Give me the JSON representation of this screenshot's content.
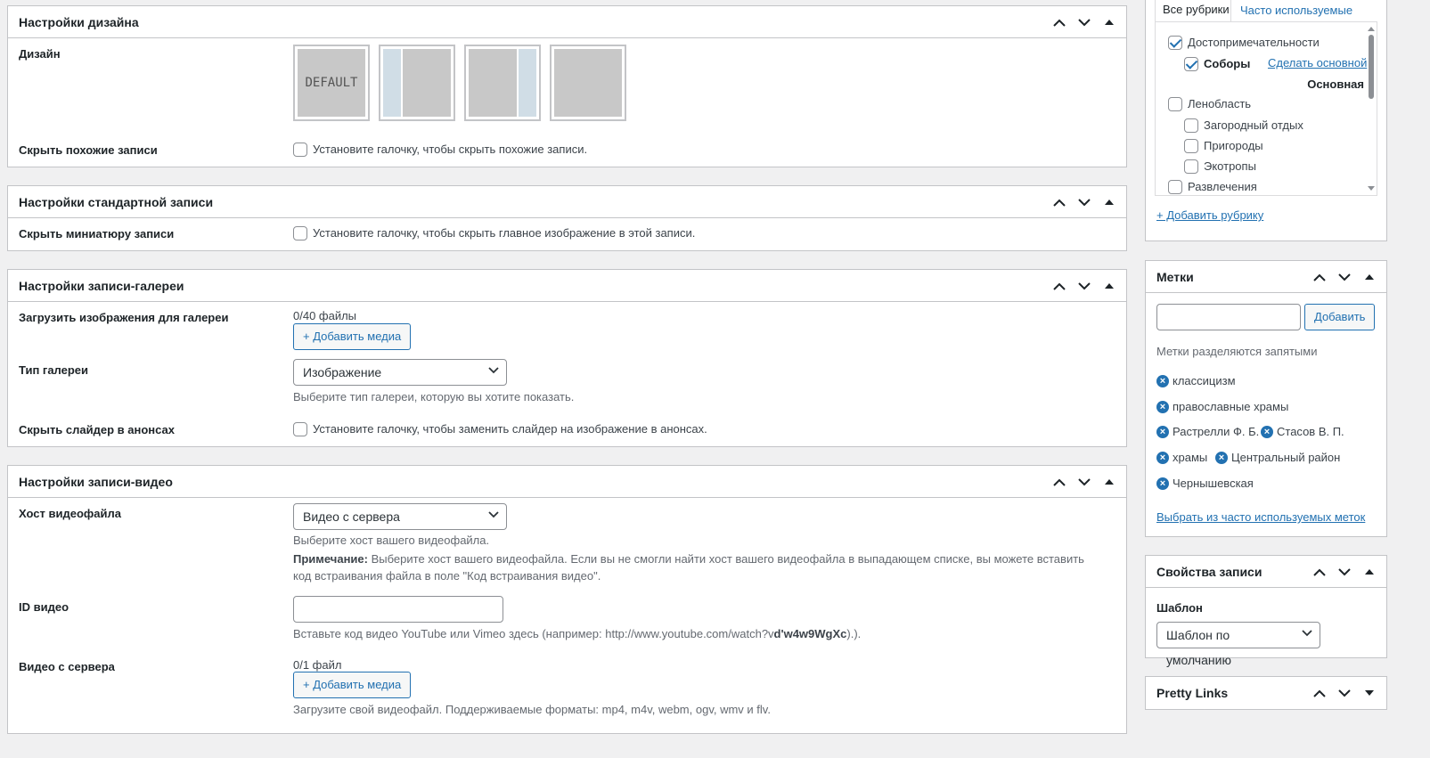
{
  "design_box": {
    "title": "Настройки дизайна",
    "design_label": "Дизайн",
    "default_option": "DEFAULT",
    "hide_related_label": "Скрыть похожие записи",
    "hide_related_text": "Установите галочку, чтобы скрыть похожие записи."
  },
  "standard_box": {
    "title": "Настройки стандартной записи",
    "hide_thumb_label": "Скрыть миниатюру записи",
    "hide_thumb_text": "Установите галочку, чтобы скрыть главное изображение в этой записи."
  },
  "gallery_box": {
    "title": "Настройки записи-галереи",
    "upload_label": "Загрузить изображения для галереи",
    "file_count": "0/40 файлы",
    "add_media": "+ Добавить медиа",
    "type_label": "Тип галереи",
    "type_value": "Изображение",
    "type_desc": "Выберите тип галереи, которую вы хотите показать.",
    "hide_slider_label": "Скрыть слайдер в анонсах",
    "hide_slider_text": "Установите галочку, чтобы заменить слайдер на изображение в анонсах."
  },
  "video_box": {
    "title": "Настройки записи-видео",
    "host_label": "Хост видеофайла",
    "host_value": "Видео с сервера",
    "host_desc": "Выберите хост вашего видеофайла.",
    "note_label": "Примечание:",
    "note_text": " Выберите хост вашего видеофайла. Если вы не смогли найти хост вашего видеофайла в выпадающем списке, вы можете вставить код встраивания файла в поле \"Код встраивания видео\".",
    "id_label": "ID видео",
    "id_value": "",
    "id_desc": "Вставьте код видео YouTube или Vimeo здесь (например: http://www.youtube.com/watch?v",
    "id_desc_bold": "d'w4w9WgXc",
    "id_desc_end": ").).",
    "server_label": "Видео с сервера",
    "server_count": "0/1 файл",
    "add_media": "+ Добавить медиа",
    "server_desc": "Загрузите свой видеофайл. Поддерживаемые форматы: mp4, m4v, webm, ogv, wmv и flv."
  },
  "categories": {
    "tab_all": "Все рубрики",
    "tab_popular": "Часто используемые",
    "items": [
      {
        "label": "Достопримечательности",
        "checked": true
      },
      {
        "label": "Соборы",
        "checked": true
      },
      {
        "label": "Ленобласть",
        "checked": false
      },
      {
        "label": "Загородный отдых",
        "checked": false
      },
      {
        "label": "Пригороды",
        "checked": false
      },
      {
        "label": "Экотропы",
        "checked": false
      },
      {
        "label": "Развлечения",
        "checked": false
      }
    ],
    "make_primary": "Сделать основной",
    "primary": "Основная",
    "add_category": "+ Добавить рубрику"
  },
  "tags_box": {
    "title": "Метки",
    "input_value": "",
    "add_button": "Добавить",
    "hint": "Метки разделяются запятыми",
    "tags": [
      "классицизм",
      "православные храмы",
      "Растрелли Ф. Б.",
      "Стасов В. П.",
      "храмы",
      "Центральный район",
      "Чернышевская"
    ],
    "choose_link": "Выбрать из часто используемых меток"
  },
  "props_box": {
    "title": "Свойства записи",
    "template_label": "Шаблон",
    "template_value": "Шаблон по умолчанию"
  },
  "pretty_box": {
    "title": "Pretty Links"
  },
  "colors": {
    "accent": "#2271b1",
    "border": "#c3c4c7",
    "background": "#f0f0f1"
  }
}
